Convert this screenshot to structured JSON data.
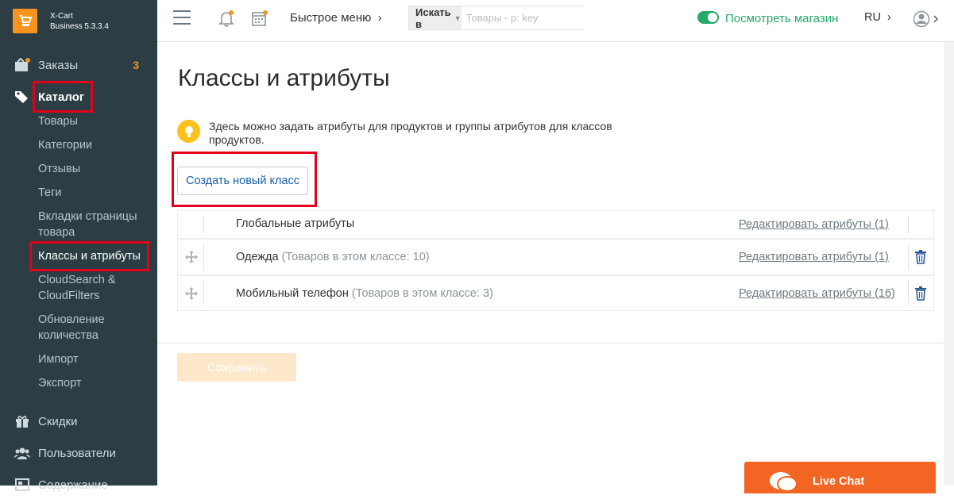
{
  "app": {
    "logo_line1": "X-Cart",
    "logo_line2": "Business 5.3.3.4"
  },
  "header": {
    "quick_menu": "Быстрое меню",
    "search_button": "Искать в",
    "search_placeholder": "Товары - p: key",
    "view_store": "Посмотреть магазин",
    "language": "RU"
  },
  "sidebar": {
    "orders": {
      "label": "Заказы",
      "badge": "3"
    },
    "catalog": {
      "label": "Каталог"
    },
    "catalog_items": [
      {
        "label": "Товары"
      },
      {
        "label": "Категории"
      },
      {
        "label": "Отзывы"
      },
      {
        "label": "Теги"
      },
      {
        "label": "Вкладки страницы товара"
      },
      {
        "label": "Классы и атрибуты"
      },
      {
        "label": "CloudSearch & CloudFilters"
      },
      {
        "label": "Обновление количества"
      },
      {
        "label": "Импорт"
      },
      {
        "label": "Экспорт"
      }
    ],
    "discounts": {
      "label": "Скидки"
    },
    "users": {
      "label": "Пользователи"
    },
    "content": {
      "label": "Содержание"
    }
  },
  "page": {
    "title": "Классы и атрибуты",
    "hint": "Здесь можно задать атрибуты для продуктов и группы атрибутов для классов продуктов.",
    "create_button": "Создать новый класс",
    "save_button": "Сохранить"
  },
  "classes": [
    {
      "name": "Глобальные атрибуты",
      "count_text": "",
      "edit_label": "Редактировать атрибуты (1)"
    },
    {
      "name": "Одежда",
      "count_text": "(Товаров в этом классе: 10)",
      "edit_label": "Редактировать атрибуты (1)"
    },
    {
      "name": "Мобильный телефон",
      "count_text": "(Товаров в этом классе: 3)",
      "edit_label": "Редактировать атрибуты (16)"
    }
  ],
  "livechat": {
    "label": "Live Chat"
  },
  "colors": {
    "sidebar_bg": "#2c3e44",
    "accent": "#f7941d",
    "store_green": "#26a86b",
    "highlight_red": "#e2001a"
  }
}
